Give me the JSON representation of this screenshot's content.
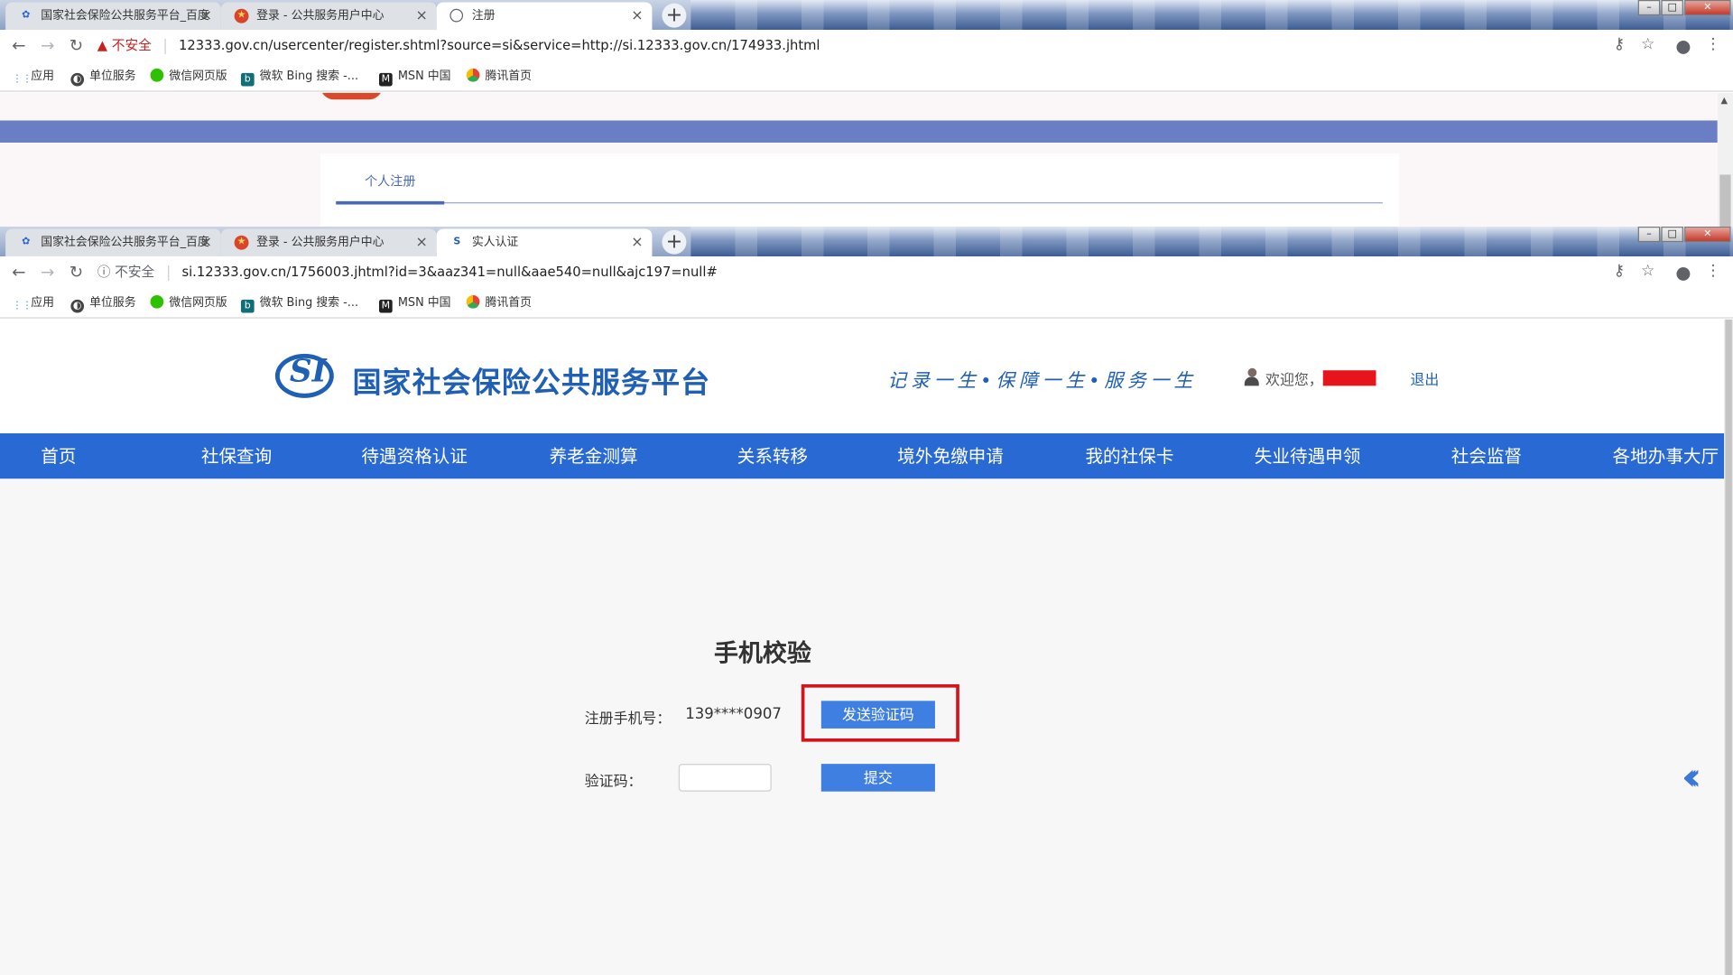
{
  "browser_top": {
    "tabs": [
      {
        "title": "国家社会保险公共服务平台_百度",
        "icon": "paw-icon"
      },
      {
        "title": "登录 - 公共服务用户中心",
        "icon": "emblem-icon"
      },
      {
        "title": "注册",
        "icon": "globe-icon",
        "active": true
      }
    ],
    "security_label": "不安全",
    "url": "12333.gov.cn/usercenter/register.shtml?source=si&service=http://si.12333.gov.cn/174933.jhtml"
  },
  "browser_bottom": {
    "tabs": [
      {
        "title": "国家社会保险公共服务平台_百度",
        "icon": "paw-icon"
      },
      {
        "title": "登录 - 公共服务用户中心",
        "icon": "emblem-icon"
      },
      {
        "title": "实人认证",
        "icon": "si-icon",
        "active": true
      }
    ],
    "security_label": "不安全",
    "url": "si.12333.gov.cn/1756003.jhtml?id=3&aaz341=null&aae540=null&ajc197=null#"
  },
  "bookmarks": [
    "应用",
    "单位服务",
    "微信网页版",
    "微软 Bing 搜索 -...",
    "MSN 中国",
    "腾讯首页"
  ],
  "register_page": {
    "tab_label": "个人注册"
  },
  "site": {
    "logo_text": "SI",
    "title": "国家社会保险公共服务平台",
    "slogan": "记录一生•保障一生•服务一生",
    "welcome": "欢迎您，",
    "logout": "退出"
  },
  "nav": [
    "首页",
    "社保查询",
    "待遇资格认证",
    "养老金测算",
    "关系转移",
    "境外免缴申请",
    "我的社保卡",
    "失业待遇申领",
    "社会监督",
    "各地办事大厅"
  ],
  "verify": {
    "title": "手机校验",
    "phone_label": "注册手机号：",
    "phone_value": "139****0907",
    "send_code_button": "发送验证码",
    "code_label": "验证码：",
    "code_value": "",
    "submit_button": "提交"
  },
  "colors": {
    "brand_blue": "#2969d4",
    "button_blue": "#3f7fe2",
    "highlight_red": "#d4141c"
  }
}
